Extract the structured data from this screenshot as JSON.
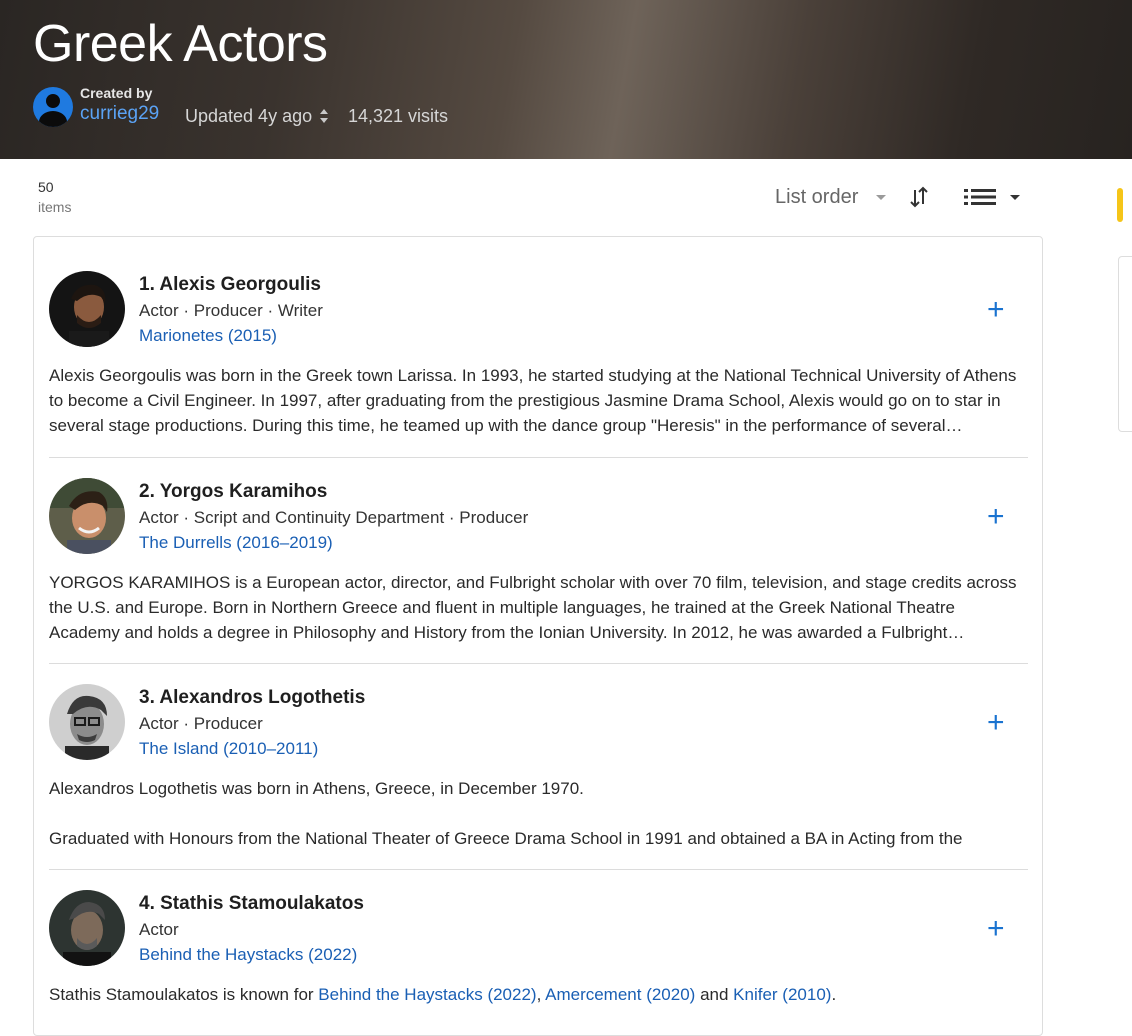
{
  "header": {
    "title": "Greek Actors",
    "created_by_label": "Created by",
    "creator": "currieg29",
    "updated": "Updated 4y ago",
    "visits": "14,321 visits"
  },
  "toolbar": {
    "count": "50",
    "count_label": "items",
    "sort_label": "List order"
  },
  "items": [
    {
      "name": "1. Alexis Georgoulis",
      "roles": "Actor  ·  Producer  ·  Writer",
      "known_for": "Marionetes (2015)",
      "bio": "Alexis Georgoulis was born in the Greek town Larissa. In 1993, he started studying at the National Technical University of Athens to become a Civil Engineer. In 1997, after graduating from the prestigious Jasmine Drama School, Alexis would go on to star in several stage productions. During this time, he teamed up with the dance group \"Heresis\" in the performance of several productions."
    },
    {
      "name": "2. Yorgos Karamihos",
      "roles": "Actor  ·  Script and Continuity Department  ·  Producer",
      "known_for": "The Durrells (2016–2019)",
      "bio": "YORGOS KARAMIHOS is a European actor, director, and Fulbright scholar with over 70 film, television, and stage credits across the U.S. and Europe. Born in Northern Greece and fluent in multiple languages, he trained at the Greek National Theatre Academy and holds a degree in Philosophy and History from the Ionian University. In 2012, he was awarded a Fulbright scholarship."
    },
    {
      "name": "3. Alexandros Logothetis",
      "roles": "Actor  ·  Producer",
      "known_for": "The Island (2010–2011)",
      "bio_line1": "Alexandros Logothetis was born in Athens, Greece, in December 1970.",
      "bio_line2": "Graduated with Honours from the National Theater of Greece Drama School in 1991 and obtained a BA in Acting from the"
    },
    {
      "name": "4. Stathis Stamoulakatos",
      "roles": "Actor",
      "known_for": "Behind the Haystacks (2022)",
      "bio_prefix": "Stathis Stamoulakatos is known for ",
      "bio_link1": "Behind the Haystacks (2022)",
      "bio_sep1": ", ",
      "bio_link2": "Amercement (2020)",
      "bio_sep2": " and ",
      "bio_link3": "Knifer (2010)",
      "bio_suffix": "."
    }
  ],
  "icons": {
    "updown": "updown-arrows-icon",
    "sort_direction": "sort-direction-icon",
    "view_mode": "list-view-icon",
    "add": "plus-icon"
  },
  "colors": {
    "accent": "#f5c518",
    "link": "#1a5fb4",
    "add_button": "#1a73d0",
    "creator_link": "#5ba3f5"
  }
}
